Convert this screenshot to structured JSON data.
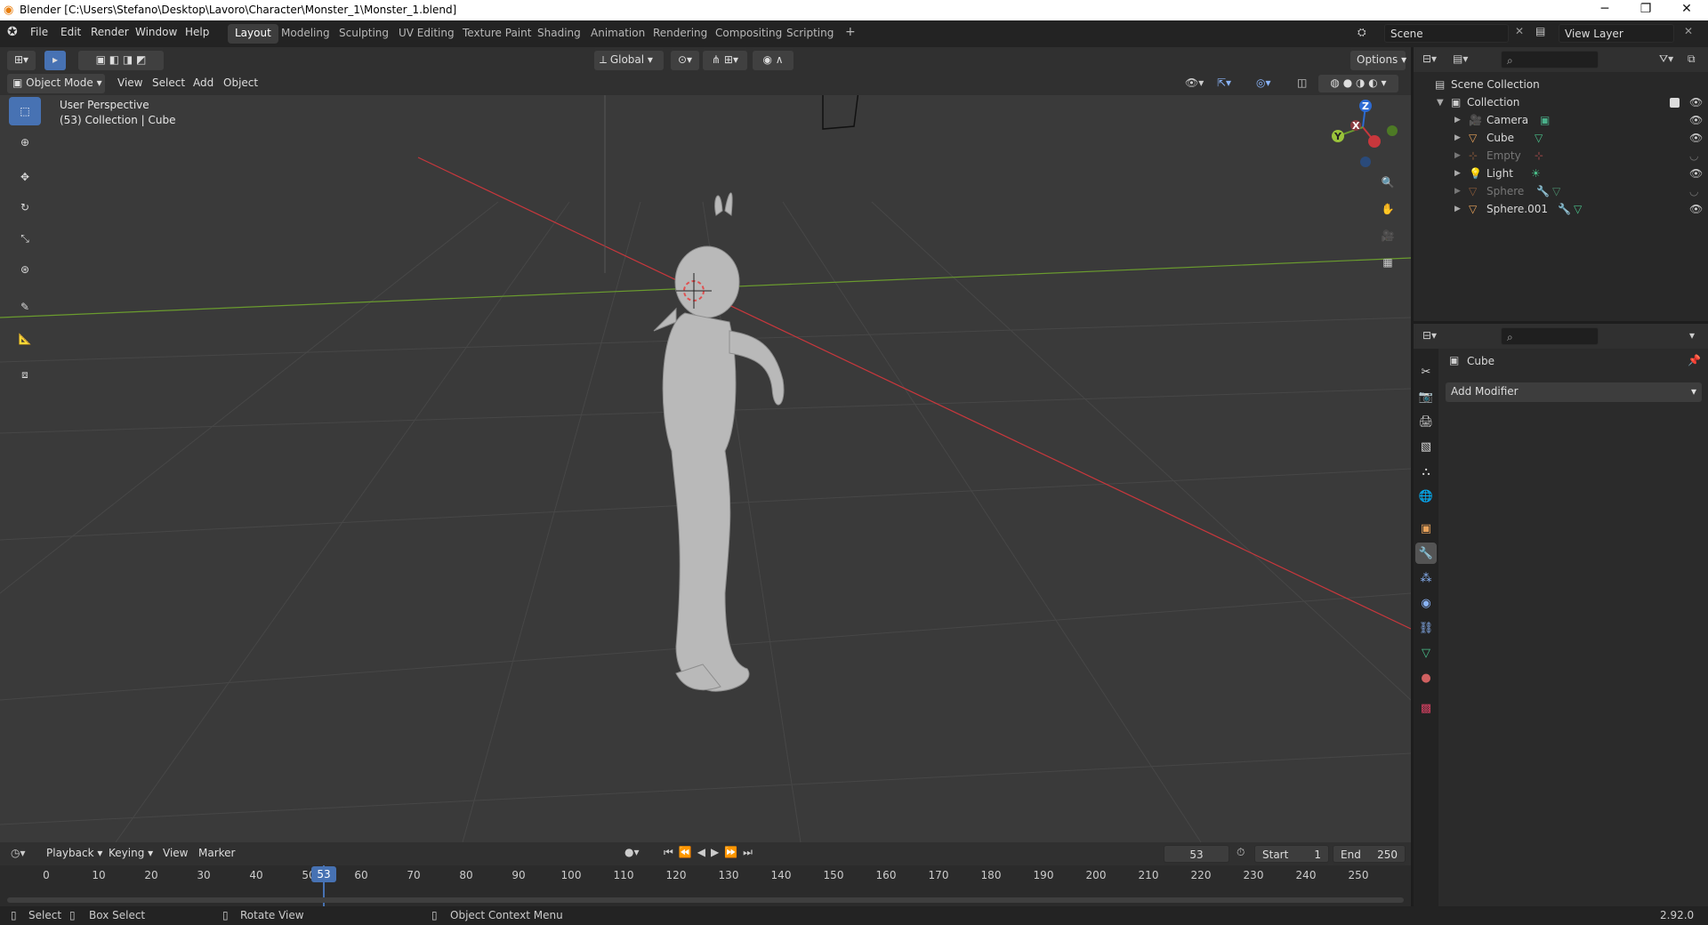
{
  "window": {
    "title": "Blender [C:\\Users\\Stefano\\Desktop\\Lavoro\\Character\\Monster_1\\Monster_1.blend]",
    "controls": [
      "─",
      "❐",
      "✕"
    ]
  },
  "menu": [
    "File",
    "Edit",
    "Render",
    "Window",
    "Help"
  ],
  "workspaces": [
    "Layout",
    "Modeling",
    "Sculpting",
    "UV Editing",
    "Texture Paint",
    "Shading",
    "Animation",
    "Rendering",
    "Compositing",
    "Scripting"
  ],
  "add_workspace": "+",
  "scene": {
    "name": "Scene",
    "view_layer": "View Layer"
  },
  "viewport": {
    "transform_orientation": "Global",
    "options_label": "Options",
    "mode": "Object Mode",
    "menus": [
      "View",
      "Select",
      "Add",
      "Object"
    ],
    "overlay_title": "User Perspective",
    "overlay_subtitle": "(53) Collection | Cube",
    "gizmo_axes": [
      "Z",
      "X",
      "Y"
    ]
  },
  "outliner": {
    "root": "Scene Collection",
    "collection": "Collection",
    "items": [
      {
        "name": "Camera",
        "icon": "camera-icon",
        "dim": false
      },
      {
        "name": "Cube",
        "icon": "mesh-icon",
        "dim": false
      },
      {
        "name": "Empty",
        "icon": "empty-icon",
        "dim": true
      },
      {
        "name": "Light",
        "icon": "light-icon",
        "dim": false
      },
      {
        "name": "Sphere",
        "icon": "mesh-icon",
        "dim": true
      },
      {
        "name": "Sphere.001",
        "icon": "mesh-icon",
        "dim": false
      }
    ]
  },
  "properties": {
    "object_name": "Cube",
    "add_modifier": "Add Modifier"
  },
  "timeline": {
    "menus": [
      "Playback",
      "Keying",
      "View",
      "Marker"
    ],
    "current_frame": "53",
    "start_label": "Start",
    "start": "1",
    "end_label": "End",
    "end": "250",
    "ticks": [
      "0",
      "10",
      "20",
      "30",
      "40",
      "50",
      "60",
      "70",
      "80",
      "90",
      "100",
      "110",
      "120",
      "130",
      "140",
      "150",
      "160",
      "170",
      "180",
      "190",
      "200",
      "210",
      "220",
      "230",
      "240",
      "250"
    ]
  },
  "statusbar": {
    "select": "Select",
    "box_select": "Box Select",
    "rotate_view": "Rotate View",
    "context_menu": "Object Context Menu",
    "version": "2.92.0"
  },
  "colors": {
    "accent": "#4772b3",
    "x_axis": "#c8373c",
    "y_axis": "#6a9b2e",
    "z_axis": "#2d6bd3"
  }
}
